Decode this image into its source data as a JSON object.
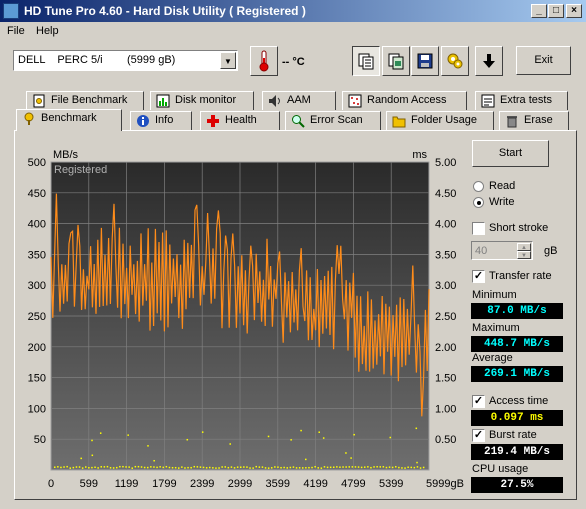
{
  "window": {
    "title": "HD Tune Pro 4.60 - Hard Disk Utility (  Registered )"
  },
  "menu": {
    "file": "File",
    "help": "Help"
  },
  "toolbar": {
    "drive": "DELL    PERC 5/i        (5999 gB)",
    "temperature": "-- °C",
    "exit": "Exit"
  },
  "tabs_top": [
    "File Benchmark",
    "Disk monitor",
    "AAM",
    "Random Access",
    "Extra tests"
  ],
  "tabs_bottom": [
    "Benchmark",
    "Info",
    "Health",
    "Error Scan",
    "Folder Usage",
    "Erase"
  ],
  "controls": {
    "start": "Start",
    "read": "Read",
    "write": "Write",
    "short_stroke": "Short stroke",
    "stroke_value": "40",
    "stroke_unit": "gB",
    "transfer_rate": "Transfer rate",
    "minimum_label": "Minimum",
    "minimum_value": "87.0 MB/s",
    "maximum_label": "Maximum",
    "maximum_value": "448.7 MB/s",
    "average_label": "Average",
    "average_value": "269.1 MB/s",
    "access_time": "Access time",
    "access_value": "0.097 ms",
    "burst_rate": "Burst rate",
    "burst_value": "219.4 MB/s",
    "cpu_label": "CPU usage",
    "cpu_value": "27.5%"
  },
  "colors": {
    "value_cyan": "#00ffff",
    "value_yellow": "#ffff00",
    "value_white": "#ffffff",
    "transfer_line": "#ff8c1a",
    "access_dots": "#ffff00"
  },
  "chart_data": {
    "type": "line",
    "watermark": "Registered",
    "ylabel_left": "MB/s",
    "ylabel_right": "ms",
    "ylim": [
      0,
      500
    ],
    "ylim_right": [
      0,
      5
    ],
    "y_ticks": [
      50,
      100,
      150,
      200,
      250,
      300,
      350,
      400,
      450,
      500
    ],
    "y2_ticks": [
      "0.50",
      "1.00",
      "1.50",
      "2.00",
      "2.50",
      "3.00",
      "3.50",
      "4.00",
      "4.50",
      "5.00"
    ],
    "x_ticks": [
      "0",
      "599",
      "1199",
      "1799",
      "2399",
      "2999",
      "3599",
      "4199",
      "4799",
      "5399",
      "5999gB"
    ],
    "xlim": [
      0,
      5999
    ],
    "grid": true,
    "series": [
      {
        "name": "Transfer rate",
        "axis": "left",
        "seed": 7,
        "segments": [
          {
            "x": [
              0,
              900
            ],
            "low": 240,
            "high": 380
          },
          {
            "x": [
              900,
              2700
            ],
            "low": 225,
            "high": 395
          },
          {
            "x": [
              2700,
              3600
            ],
            "low": 220,
            "high": 360
          },
          {
            "x": [
              3600,
              4800
            ],
            "low": 190,
            "high": 330
          },
          {
            "x": [
              4800,
              5999
            ],
            "low": 140,
            "high": 300
          }
        ],
        "min": 87.0,
        "max": 448.7,
        "avg": 269.1
      },
      {
        "name": "Access time",
        "axis": "right",
        "typical": 0.05
      }
    ]
  }
}
